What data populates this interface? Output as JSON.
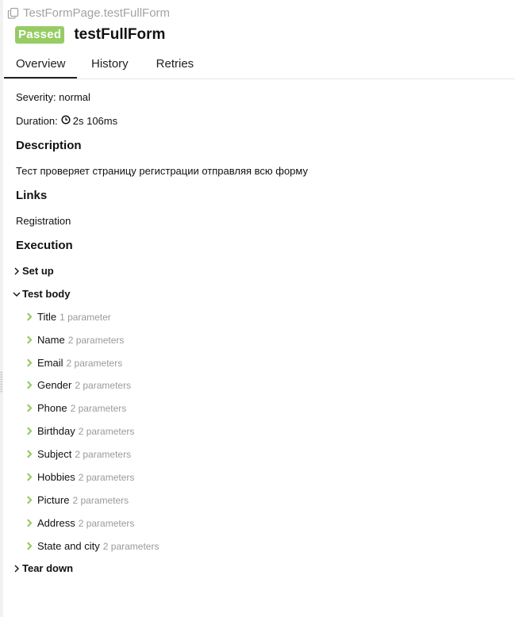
{
  "breadcrumb": {
    "icon": "copy-icon",
    "text": "TestFormPage.testFullForm"
  },
  "header": {
    "status": "Passed",
    "status_color": "#97cc64",
    "title": "testFullForm"
  },
  "tabs": [
    {
      "label": "Overview",
      "active": true
    },
    {
      "label": "History",
      "active": false
    },
    {
      "label": "Retries",
      "active": false
    }
  ],
  "overview": {
    "severity": "Severity: normal",
    "duration_label": "Duration:",
    "duration_icon": "clock-icon",
    "duration_value": "2s 106ms",
    "description_heading": "Description",
    "description_text": "Тест проверяет страницу регистрации отправляя всю форму",
    "links_heading": "Links",
    "link_text": "Registration",
    "execution_heading": "Execution"
  },
  "execution": {
    "setup": {
      "label": "Set up",
      "expanded": false
    },
    "test_body": {
      "label": "Test body",
      "expanded": true
    },
    "teardown": {
      "label": "Tear down",
      "expanded": false
    },
    "step_arrow_color": "#97cc64",
    "steps": [
      {
        "name": "Title",
        "params": "1 parameter"
      },
      {
        "name": "Name",
        "params": "2 parameters"
      },
      {
        "name": "Email",
        "params": "2 parameters"
      },
      {
        "name": "Gender",
        "params": "2 parameters"
      },
      {
        "name": "Phone",
        "params": "2 parameters"
      },
      {
        "name": "Birthday",
        "params": "2 parameters"
      },
      {
        "name": "Subject",
        "params": "2 parameters"
      },
      {
        "name": "Hobbies",
        "params": "2 parameters"
      },
      {
        "name": "Picture",
        "params": "2 parameters"
      },
      {
        "name": "Address",
        "params": "2 parameters"
      },
      {
        "name": "State and city",
        "params": "2 parameters"
      }
    ]
  }
}
